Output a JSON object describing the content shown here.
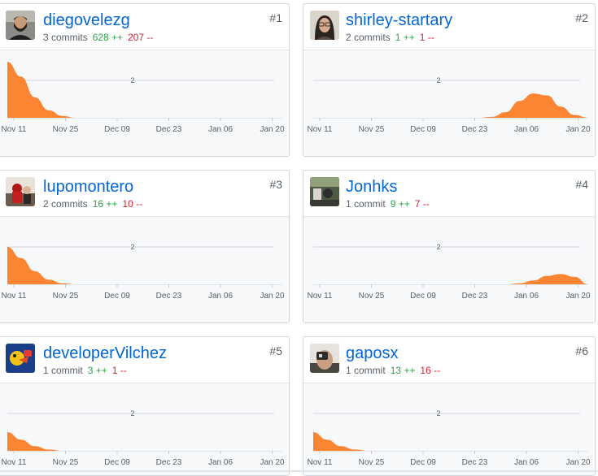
{
  "contributors": [
    {
      "username": "diegovelezg",
      "rank": "#1",
      "commits": "3 commits",
      "additions": "628 ++",
      "deletions": "207 --",
      "avatar": "person-dark-beard-avatar",
      "activity": [
        3,
        2.2,
        1.1,
        0.4,
        0.1,
        0,
        0,
        0,
        0,
        0,
        0,
        0,
        0,
        0,
        0,
        0,
        0,
        0,
        0,
        0,
        0
      ]
    },
    {
      "username": "shirley-startary",
      "rank": "#2",
      "commits": "2 commits",
      "additions": "1 ++",
      "deletions": "1 --",
      "avatar": "person-glasses-avatar",
      "activity": [
        0,
        0,
        0,
        0,
        0,
        0,
        0,
        0,
        0,
        0,
        0,
        0,
        0,
        0.05,
        0.3,
        0.9,
        1.3,
        1.2,
        0.6,
        0.15,
        0
      ]
    },
    {
      "username": "lupomontero",
      "rank": "#3",
      "commits": "2 commits",
      "additions": "16 ++",
      "deletions": "10 --",
      "avatar": "person-red-scene-avatar",
      "activity": [
        2,
        1.4,
        0.7,
        0.25,
        0.05,
        0,
        0,
        0,
        0,
        0,
        0,
        0,
        0,
        0,
        0,
        0,
        0,
        0,
        0,
        0,
        0
      ]
    },
    {
      "username": "Jonhks",
      "rank": "#4",
      "commits": "1 commit",
      "additions": "9 ++",
      "deletions": "7 --",
      "avatar": "outdoor-photo-avatar",
      "activity": [
        0,
        0,
        0,
        0,
        0,
        0,
        0,
        0,
        0,
        0,
        0,
        0,
        0,
        0,
        0,
        0.05,
        0.2,
        0.45,
        0.55,
        0.4,
        0
      ]
    },
    {
      "username": "developerVilchez",
      "rank": "#5",
      "commits": "1 commit",
      "additions": "3 ++",
      "deletions": "1 --",
      "avatar": "cartoon-logo-avatar",
      "activity": [
        1,
        0.6,
        0.25,
        0.07,
        0,
        0,
        0,
        0,
        0,
        0,
        0,
        0,
        0,
        0,
        0,
        0,
        0,
        0,
        0,
        0,
        0
      ]
    },
    {
      "username": "gaposx",
      "rank": "#6",
      "commits": "1 commit",
      "additions": "13 ++",
      "deletions": "16 --",
      "avatar": "person-hand-avatar",
      "activity": [
        1,
        0.6,
        0.25,
        0.07,
        0,
        0,
        0,
        0,
        0,
        0,
        0,
        0,
        0,
        0,
        0,
        0,
        0,
        0,
        0,
        0,
        0
      ]
    }
  ],
  "chart": {
    "x_labels": [
      "Nov 11",
      "Nov 25",
      "Dec 09",
      "Dec 23",
      "Jan 06",
      "Jan 20"
    ],
    "y_gridline": "2",
    "ymax": 3,
    "fill_color": "#fb8532",
    "grid_color": "#d1d5da",
    "label_color": "#586069"
  },
  "colors": {
    "link": "#0366d6",
    "additions": "#28a745",
    "deletions": "#cb2431",
    "muted": "#586069"
  }
}
